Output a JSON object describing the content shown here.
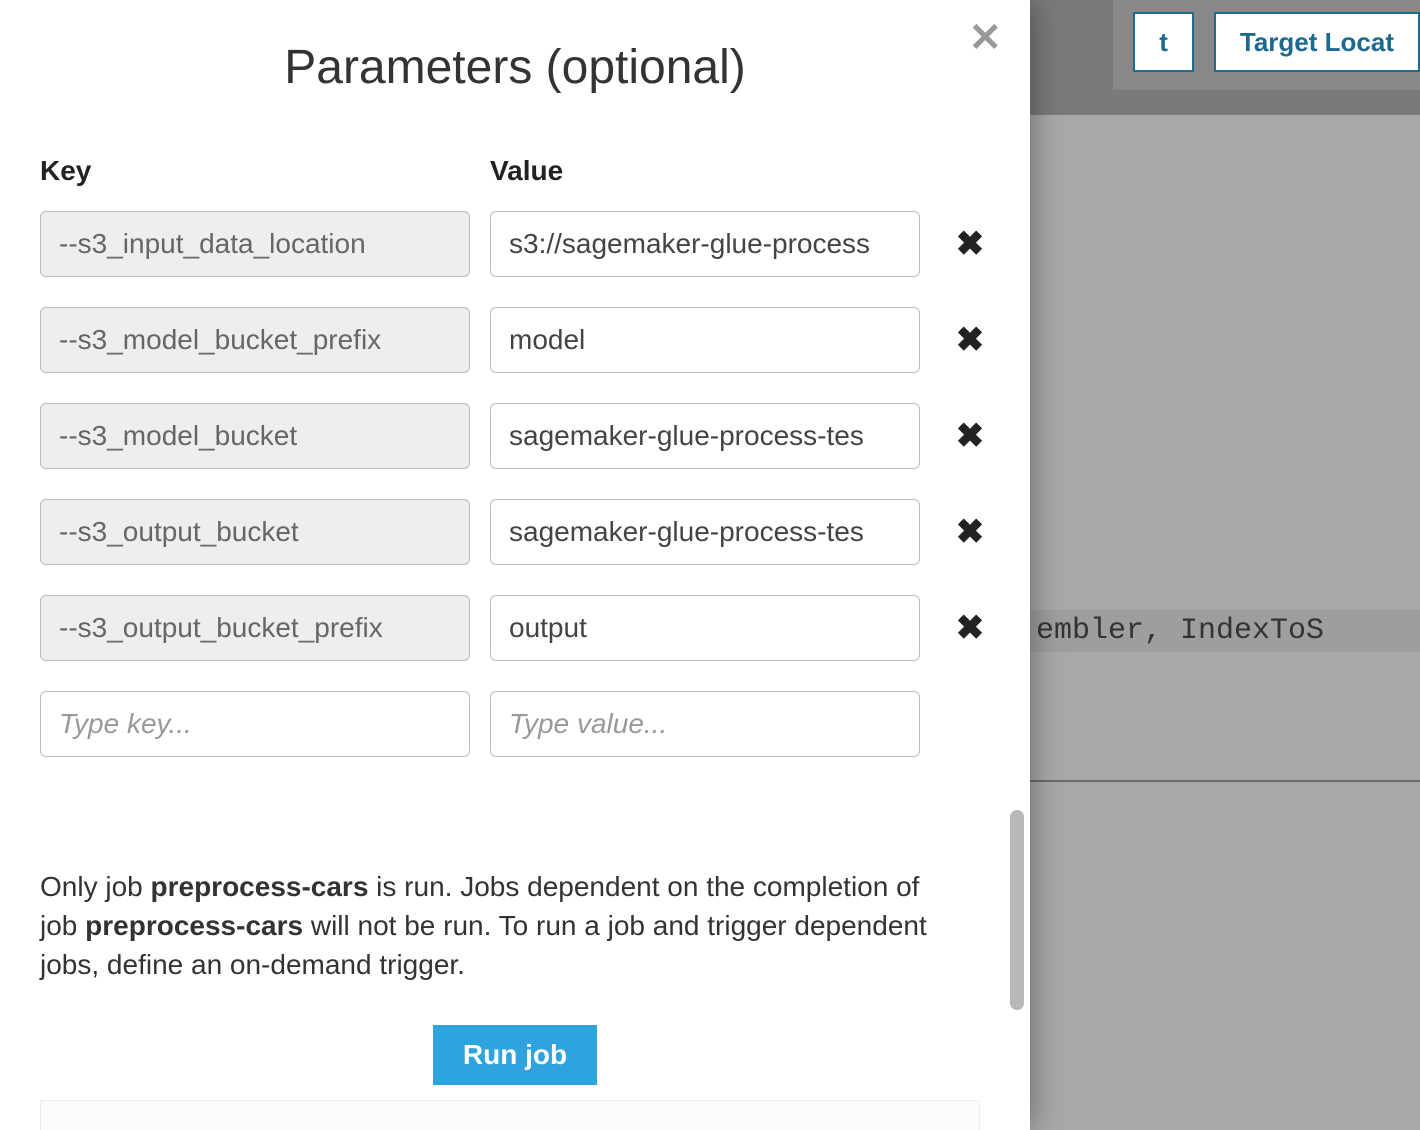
{
  "background": {
    "button1_partial": "t",
    "button2": "Target Locat",
    "code_fragment": "embler, IndexToS"
  },
  "modal": {
    "title": "Parameters (optional)",
    "key_header": "Key",
    "value_header": "Value",
    "rows": [
      {
        "key": "--s3_input_data_location",
        "value": "s3://sagemaker-glue-process"
      },
      {
        "key": "--s3_model_bucket_prefix",
        "value": "model"
      },
      {
        "key": "--s3_model_bucket",
        "value": "sagemaker-glue-process-tes"
      },
      {
        "key": "--s3_output_bucket",
        "value": "sagemaker-glue-process-tes"
      },
      {
        "key": "--s3_output_bucket_prefix",
        "value": "output"
      }
    ],
    "new_key_placeholder": "Type key...",
    "new_value_placeholder": "Type value...",
    "info_prefix": "Only job ",
    "job_name": "preprocess-cars",
    "info_mid": " is run. Jobs dependent on the completion of job ",
    "info_suffix": " will not be run. To run a job and trigger dependent jobs, define an on-demand trigger.",
    "run_button": "Run job"
  }
}
